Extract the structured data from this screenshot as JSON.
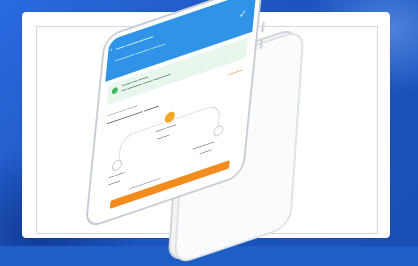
{
  "colors": {
    "background": "#1f5ec4",
    "phone_header": "#2f93e8",
    "alert_bg": "#e8f6ec",
    "accent_orange": "#f28c1e"
  },
  "icons": {
    "back": "chevron-left-icon",
    "confirm": "checkmark-icon",
    "status": "status-dot-icon"
  }
}
